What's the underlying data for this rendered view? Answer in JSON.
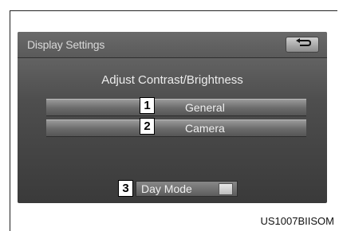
{
  "screen": {
    "title": "Display Settings",
    "subtitle": "Adjust Contrast/Brightness",
    "back_icon": "back-arrow-icon",
    "buttons": [
      {
        "label": "General",
        "callout": "1"
      },
      {
        "label": "Camera",
        "callout": "2"
      }
    ],
    "day_mode": {
      "label": "Day Mode",
      "callout": "3"
    }
  },
  "figure_code": "US1007BIISOM"
}
